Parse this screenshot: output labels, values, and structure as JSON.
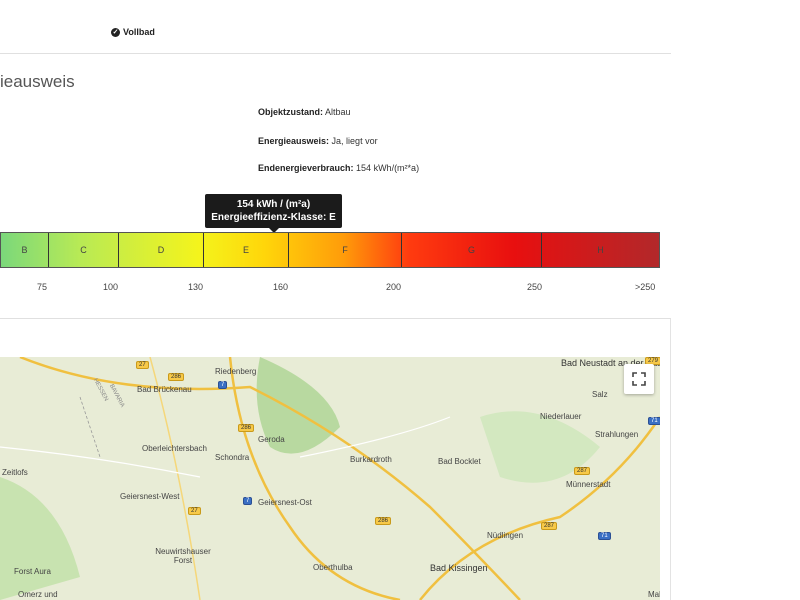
{
  "features": {
    "vollbad": "Vollbad"
  },
  "energy": {
    "title": "ieausweis",
    "info": [
      {
        "label": "Objektzustand:",
        "value": "Altbau"
      },
      {
        "label": "Energieausweis:",
        "value": "Ja, liegt vor"
      },
      {
        "label": "Endenergieverbrauch:",
        "value": "154 kWh/(m²*a)"
      }
    ],
    "tooltip": {
      "line1": "154 kWh / (m²a)",
      "line2": "Energieeffizienz-Klasse: E"
    },
    "classes": [
      "B",
      "C",
      "D",
      "E",
      "F",
      "G",
      "H"
    ],
    "scale": [
      "75",
      "100",
      "130",
      "160",
      "200",
      "250",
      ">250"
    ],
    "current_value": 154,
    "current_class": "E"
  },
  "map": {
    "labels": [
      "Bad Neustadt an der Saale",
      "Riedenberg",
      "Bad Brückenau",
      "HESSEN",
      "BAVARIA",
      "Oberleichtersbach",
      "Schondra",
      "Geroda",
      "Burkardroth",
      "Bad Bocklet",
      "Niederlauer",
      "Salz",
      "Strahlungen",
      "Zeitlofs",
      "Geiersnest-West",
      "Geiersnest-Ost",
      "Münnerstadt",
      "Neuwirtshauser Forst",
      "Nüdlingen",
      "Forst Aura",
      "Oberthulba",
      "Bad Kissingen",
      "Omerz und",
      "Mal"
    ],
    "road_numbers": [
      "27",
      "286",
      "7",
      "286",
      "279",
      "71",
      "27",
      "7",
      "286",
      "287",
      "287",
      "71"
    ]
  },
  "colors": {
    "tooltip_bg": "#1b1b1b",
    "border": "#e0e0e0"
  },
  "icons": [
    "check-circle-icon",
    "fullscreen-icon"
  ]
}
